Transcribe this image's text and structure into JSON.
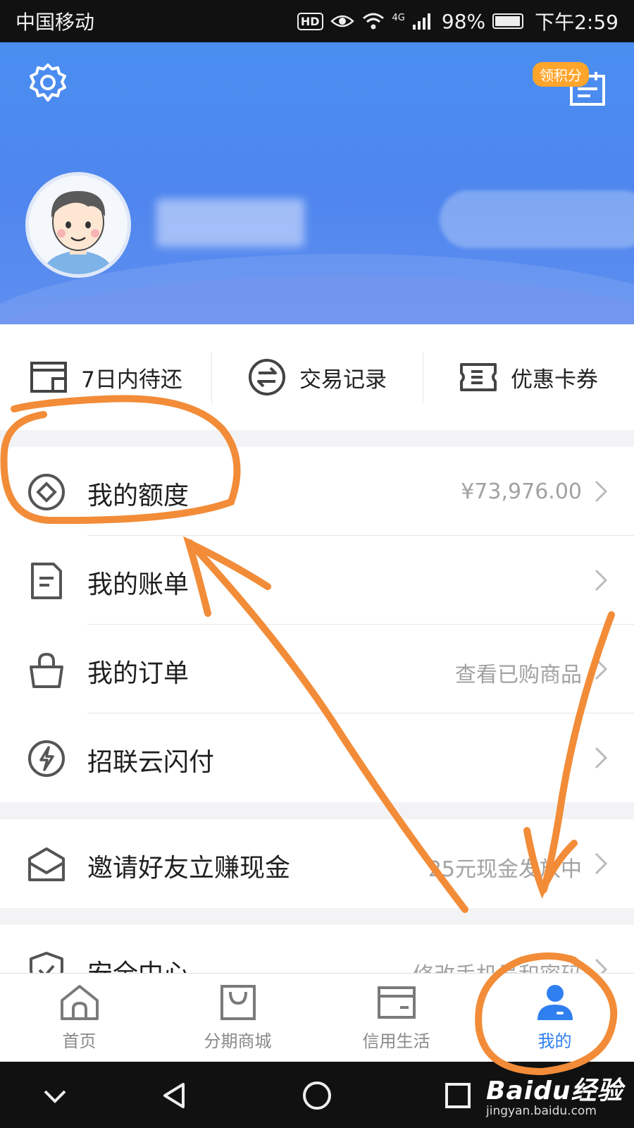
{
  "status_bar": {
    "carrier": "中国移动",
    "hd": "HD",
    "network": "4G",
    "battery": "98%",
    "time": "下午2:59"
  },
  "header": {
    "points_badge": "领积分"
  },
  "quick_actions": [
    {
      "label": "7日内待还",
      "icon": "wallet-icon"
    },
    {
      "label": "交易记录",
      "icon": "exchange-icon"
    },
    {
      "label": "优惠卡券",
      "icon": "coupon-icon"
    }
  ],
  "menu": {
    "credit_limit": {
      "label": "我的额度",
      "value": "¥73,976.00",
      "icon": "diamond-icon"
    },
    "bills": {
      "label": "我的账单",
      "value": "",
      "icon": "bill-icon"
    },
    "orders": {
      "label": "我的订单",
      "value": "查看已购商品",
      "icon": "shopping-bag-icon"
    },
    "quickpass": {
      "label": "招联云闪付",
      "value": "",
      "icon": "lightning-icon"
    },
    "invite": {
      "label": "邀请好友立赚现金",
      "value": "25元现金发放中",
      "icon": "envelope-icon"
    },
    "security": {
      "label": "安全中心",
      "value": "修改手机号和密码",
      "icon": "shield-icon"
    }
  },
  "tabs": [
    {
      "label": "首页",
      "icon": "home-icon",
      "active": false
    },
    {
      "label": "分期商城",
      "icon": "mall-bag-icon",
      "active": false
    },
    {
      "label": "信用生活",
      "icon": "card-icon",
      "active": false
    },
    {
      "label": "我的",
      "icon": "person-icon",
      "active": true
    }
  ],
  "watermark": {
    "brand": "Baidu经验",
    "url": "jingyan.baidu.com"
  },
  "colors": {
    "header_blue": "#4a8ef0",
    "active_tab": "#2f7ff0",
    "annotation_orange": "#f28c38",
    "badge_orange": "#ffa52c"
  }
}
